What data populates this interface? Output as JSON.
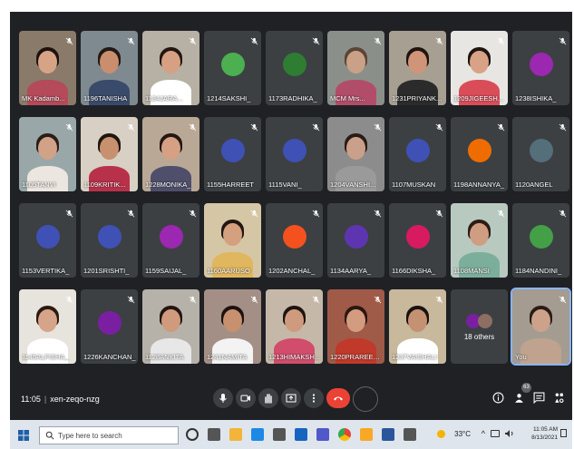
{
  "meeting": {
    "time": "11:05",
    "separator": "|",
    "code": "xen-zeqo-nzg"
  },
  "participant_count_badge": "63",
  "participants": [
    {
      "name": "MK Kadamb...",
      "type": "video",
      "skin": "#d7a387",
      "hair": "#1d1210",
      "shirt": "#b44a5a",
      "bg": "#8a7a6a"
    },
    {
      "name": "1196TANISHA",
      "type": "video",
      "skin": "#c98e6e",
      "hair": "#231814",
      "shirt": "#3a4a6a",
      "bg": "#7e8a8f"
    },
    {
      "name": "1134JARA...",
      "type": "video",
      "skin": "#d6a083",
      "hair": "#22160f",
      "shirt": "#ffffff",
      "bg": "#b7b0a4"
    },
    {
      "name": "1214SAKSHI_",
      "type": "avatar",
      "color": "#4caf50"
    },
    {
      "name": "1173RADHIKA_",
      "type": "avatar",
      "color": "#2e7d32"
    },
    {
      "name": "MCM Mrs...",
      "type": "video",
      "skin": "#caa186",
      "hair": "#5a4438",
      "shirt": "#b24d69",
      "bg": "#8b8f8a"
    },
    {
      "name": "1231PRIYANK...",
      "type": "video",
      "skin": "#d09478",
      "hair": "#1f1410",
      "shirt": "#2b2b2b",
      "bg": "#a79f92"
    },
    {
      "name": "1209JIGEESH...",
      "type": "video",
      "skin": "#d8a286",
      "hair": "#1e1411",
      "shirt": "#d94d59",
      "bg": "#e8e6e2"
    },
    {
      "name": "1238ISHIKA_",
      "type": "avatar",
      "color": "#9c27b0"
    },
    {
      "name": "1105TANVI",
      "type": "video",
      "skin": "#d1a188",
      "hair": "#2a1e17",
      "shirt": "#ece6e0",
      "bg": "#9aa7a8"
    },
    {
      "name": "1109KRITIK...",
      "type": "video",
      "skin": "#c7906f",
      "hair": "#201510",
      "shirt": "#b8314a",
      "bg": "#d8d0c4"
    },
    {
      "name": "1228MONIKA_",
      "type": "video",
      "skin": "#d5a084",
      "hair": "#231712",
      "shirt": "#4f4f6b",
      "bg": "#b9a896"
    },
    {
      "name": "1155HARREET",
      "type": "avatar",
      "color": "#3f51b5"
    },
    {
      "name": "1115VANI_",
      "type": "avatar",
      "color": "#3f51b5"
    },
    {
      "name": "1204VANSHI...",
      "type": "video",
      "skin": "#caa08a",
      "hair": "#2a1b14",
      "shirt": "#9a9a9a",
      "bg": "#8c8c8c"
    },
    {
      "name": "1107MUSKAN",
      "type": "avatar",
      "color": "#3f51b5"
    },
    {
      "name": "1198ANNANYA_",
      "type": "avatar",
      "color": "#ef6c00"
    },
    {
      "name": "1120ANGEL",
      "type": "avatar",
      "color": "#546e7a"
    },
    {
      "name": "1153VERTIKA_",
      "type": "avatar",
      "color": "#3f51b5"
    },
    {
      "name": "1201SRISHTI_",
      "type": "avatar",
      "color": "#3f51b5"
    },
    {
      "name": "1159SAIJAL_",
      "type": "avatar",
      "color": "#9c27b0"
    },
    {
      "name": "1160AARUSO",
      "type": "video",
      "skin": "#d4a07e",
      "hair": "#231612",
      "shirt": "#e0b65e",
      "bg": "#d5c7a5"
    },
    {
      "name": "1202ANCHAL_",
      "type": "avatar",
      "color": "#f4511e"
    },
    {
      "name": "1134AARYA_",
      "type": "avatar",
      "color": "#5e35b1"
    },
    {
      "name": "1166DIKSHA_",
      "type": "avatar",
      "color": "#d81b60"
    },
    {
      "name": "1108MANSI",
      "type": "video",
      "skin": "#cf9e82",
      "hair": "#2b1d15",
      "shirt": "#7cae9c",
      "bg": "#b8c9c0"
    },
    {
      "name": "1184NANDINI_",
      "type": "avatar",
      "color": "#43a047"
    },
    {
      "name": "1145ALFISHA_",
      "type": "video",
      "skin": "#d6a488",
      "hair": "#2a1a14",
      "shirt": "#ffffff",
      "bg": "#e7e3dd"
    },
    {
      "name": "1226KANCHAN_",
      "type": "avatar",
      "color": "#7b1fa2"
    },
    {
      "name": "1128ANKITA",
      "type": "video",
      "skin": "#d09a7c",
      "hair": "#221510",
      "shirt": "#e7e7e7",
      "bg": "#b6b2aa"
    },
    {
      "name": "1241NAMITA",
      "type": "video",
      "skin": "#c7906f",
      "hair": "#1c120e",
      "shirt": "#f3f3f3",
      "bg": "#a38f85"
    },
    {
      "name": "1213HIMAKSH...",
      "type": "video",
      "skin": "#cf9b7f",
      "hair": "#1f140f",
      "shirt": "#d14d6b",
      "bg": "#c6b8a8"
    },
    {
      "name": "1220PRAREEK...",
      "type": "video",
      "skin": "#d39c80",
      "hair": "#2a1810",
      "shirt": "#c0392b",
      "bg": "#a05a48"
    },
    {
      "name": "1237VAISHALI",
      "type": "video",
      "skin": "#c59173",
      "hair": "#1b120e",
      "shirt": "#ffffff",
      "bg": "#c8b89c"
    },
    {
      "name": "18 others",
      "type": "others"
    },
    {
      "name": "You",
      "type": "self",
      "skin": "#cda28a",
      "hair": "#2a1b15",
      "shirt": "#bfa38e",
      "bg": "#a49c91"
    }
  ],
  "others": {
    "label": "18 others",
    "colors": [
      "#7b1fa2",
      "#8d6e63"
    ]
  },
  "taskbar": {
    "search_placeholder": "Type here to search",
    "weather": "33°C",
    "clock_time": "11:05 AM",
    "clock_date": "8/13/2021",
    "icons": [
      "start-icon",
      "cortana-icon",
      "task-view-icon",
      "file-explorer-icon",
      "edge-icon",
      "store-icon",
      "mail-icon",
      "teams-icon",
      "chrome-icon",
      "media-icon",
      "word-icon",
      "settings-icon"
    ]
  },
  "colors": {
    "meet_bg": "#202124",
    "tile_bg": "#3c4043",
    "end_call": "#ea4335",
    "self_border": "#8ab4f8"
  }
}
